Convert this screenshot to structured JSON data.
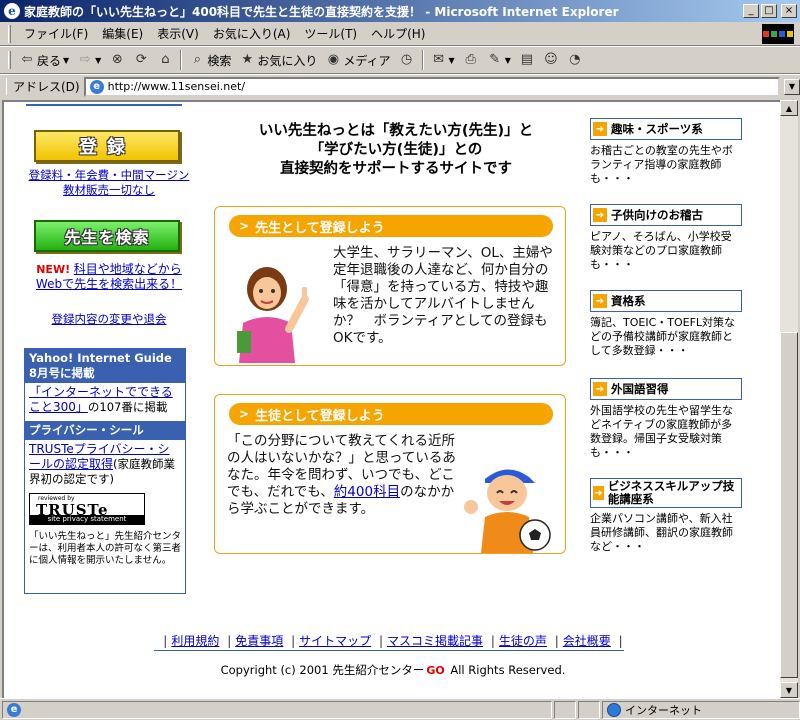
{
  "window": {
    "title": "家庭教師の「いい先生ねっと」400科目で先生と生徒の直接契約を支援！ - Microsoft Internet Explorer"
  },
  "menu": [
    "ファイル(F)",
    "編集(E)",
    "表示(V)",
    "お気に入り(A)",
    "ツール(T)",
    "ヘルプ(H)"
  ],
  "toolbar": {
    "back": "戻る",
    "search": "検索",
    "favorites": "お気に入り",
    "media": "メディア"
  },
  "address": {
    "label": "アドレス(D)",
    "url": "http://www.11sensei.net/"
  },
  "left": {
    "register_label": "登録",
    "register_note": "登録料・年会費・中間マージン教材販売一切なし",
    "search_label": "先生を検索",
    "new_badge": "NEW!",
    "search_note": "科目や地域などからWebで先生を検索出来る！",
    "change_link": "登録内容の変更や退会",
    "yahoo_head": "Yahoo! Internet Guide 8月号に掲載",
    "yahoo_link": "「インターネットでできること300」",
    "yahoo_text": "の107番に掲載",
    "privacy_head": "プライバシー・シール",
    "truste_link": "TRUSTeプライバシー・シールの認定取得",
    "truste_text": "(家庭教師業界初の認定です)",
    "truste_reviewed": "reviewed by",
    "truste_name": "TRUSTe",
    "truste_sub": "site privacy statement",
    "privacy_note": "「いい先生ねっと」先生紹介センターは、利用者本人の許可なく第三者に個人情報を開示いたしません。"
  },
  "center": {
    "headline1": "いい先生ねっとは「教えたい方(先生)」と",
    "headline2": "「学びたい方(生徒)」との",
    "headline3": "直接契約をサポートするサイトです",
    "teacher_tab": "先生として登録しよう",
    "teacher_text": "大学生、サラリーマン、OL、主婦や定年退職後の人達など、何か自分の「得意」を持っている方、特技や趣味を活かしてアルバイトしませんか？　ボランティアとしての登録もOKです。",
    "student_tab": "生徒として登録しよう",
    "student_text_pre": "「この分野について教えてくれる近所の人はいないかな？」と思っているあなた。年令を問わず、いつでも、どこでも、だれでも、",
    "student_link": "約400科目",
    "student_text_post": "のなかから学ぶことができます。"
  },
  "right": {
    "categories": [
      {
        "title": "趣味・スポーツ系",
        "text": "お稽古ごとの教室の先生やボランティア指導の家庭教師も・・・"
      },
      {
        "title": "子供向けのお稽古",
        "text": "ピアノ、そろばん、小学校受験対策などのプロ家庭教師も・・・"
      },
      {
        "title": "資格系",
        "text": "簿記、TOEIC・TOEFL対策などの予備校講師が家庭教師として多数登録・・・"
      },
      {
        "title": "外国語習得",
        "text": "外国語学校の先生や留学生などネイティブの家庭教師が多数登録。帰国子女受験対策も・・・"
      },
      {
        "title": "ビジネススキルアップ技能講座系",
        "text": "企業パソコン講師や、新入社員研修講師、翻訳の家庭教師など・・・"
      }
    ]
  },
  "footer": {
    "links": [
      "利用規約",
      "免責事項",
      "サイトマップ",
      "マスコミ掲載記事",
      "生徒の声",
      "会社概要"
    ],
    "copyright_pre": "Copyright (c) 2001 先生紹介センター",
    "copyright_post": " All Rights Reserved.",
    "logo_mark": "GO"
  },
  "status": {
    "zone": "インターネット"
  }
}
